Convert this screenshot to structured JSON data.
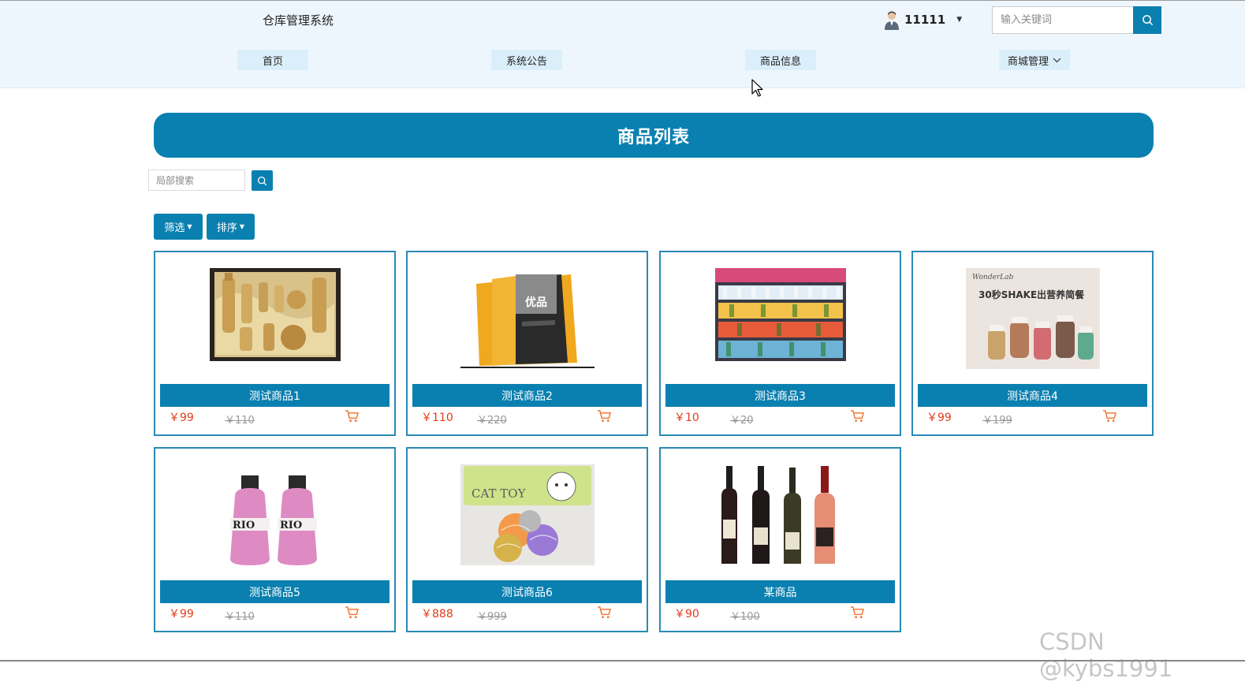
{
  "header": {
    "brand": "仓库管理系统",
    "username": "11111",
    "search_placeholder": "输入关键词"
  },
  "nav": [
    {
      "label": "首页"
    },
    {
      "label": "系统公告"
    },
    {
      "label": "商品信息"
    },
    {
      "label": "商城管理"
    }
  ],
  "page_title": "商品列表",
  "local_search_placeholder": "局部搜索",
  "filter_label": "筛选",
  "sort_label": "排序",
  "products": [
    {
      "name": "测试商品1",
      "price": "￥99",
      "old_price": "￥110",
      "image": "cosmetics-gift-set"
    },
    {
      "name": "测试商品2",
      "price": "￥110",
      "old_price": "￥220",
      "image": "pet-food-bag"
    },
    {
      "name": "测试商品3",
      "price": "￥10",
      "old_price": "￥20",
      "image": "drinks-shelf"
    },
    {
      "name": "测试商品4",
      "price": "￥99",
      "old_price": "￥199",
      "image": "shake-meal-bottles"
    },
    {
      "name": "测试商品5",
      "price": "￥99",
      "old_price": "￥110",
      "image": "rio-cocktail-bottles"
    },
    {
      "name": "测试商品6",
      "price": "￥888",
      "old_price": "￥999",
      "image": "cat-toy-balls"
    },
    {
      "name": "某商品",
      "price": "￥90",
      "old_price": "￥100",
      "image": "wine-bottles"
    }
  ],
  "product4_image_text": "30秒SHAKE出营养简餐",
  "product4_brand": "WonderLab",
  "product2_brand_text": "优品",
  "product5_label": "RIO",
  "product6_label": "CAT TOY",
  "watermark": "CSDN @kybs1991",
  "colors": {
    "primary": "#0a80b0",
    "header_bg": "#eef6fd",
    "price": "#e03b1b",
    "cart": "#f07a3a"
  }
}
